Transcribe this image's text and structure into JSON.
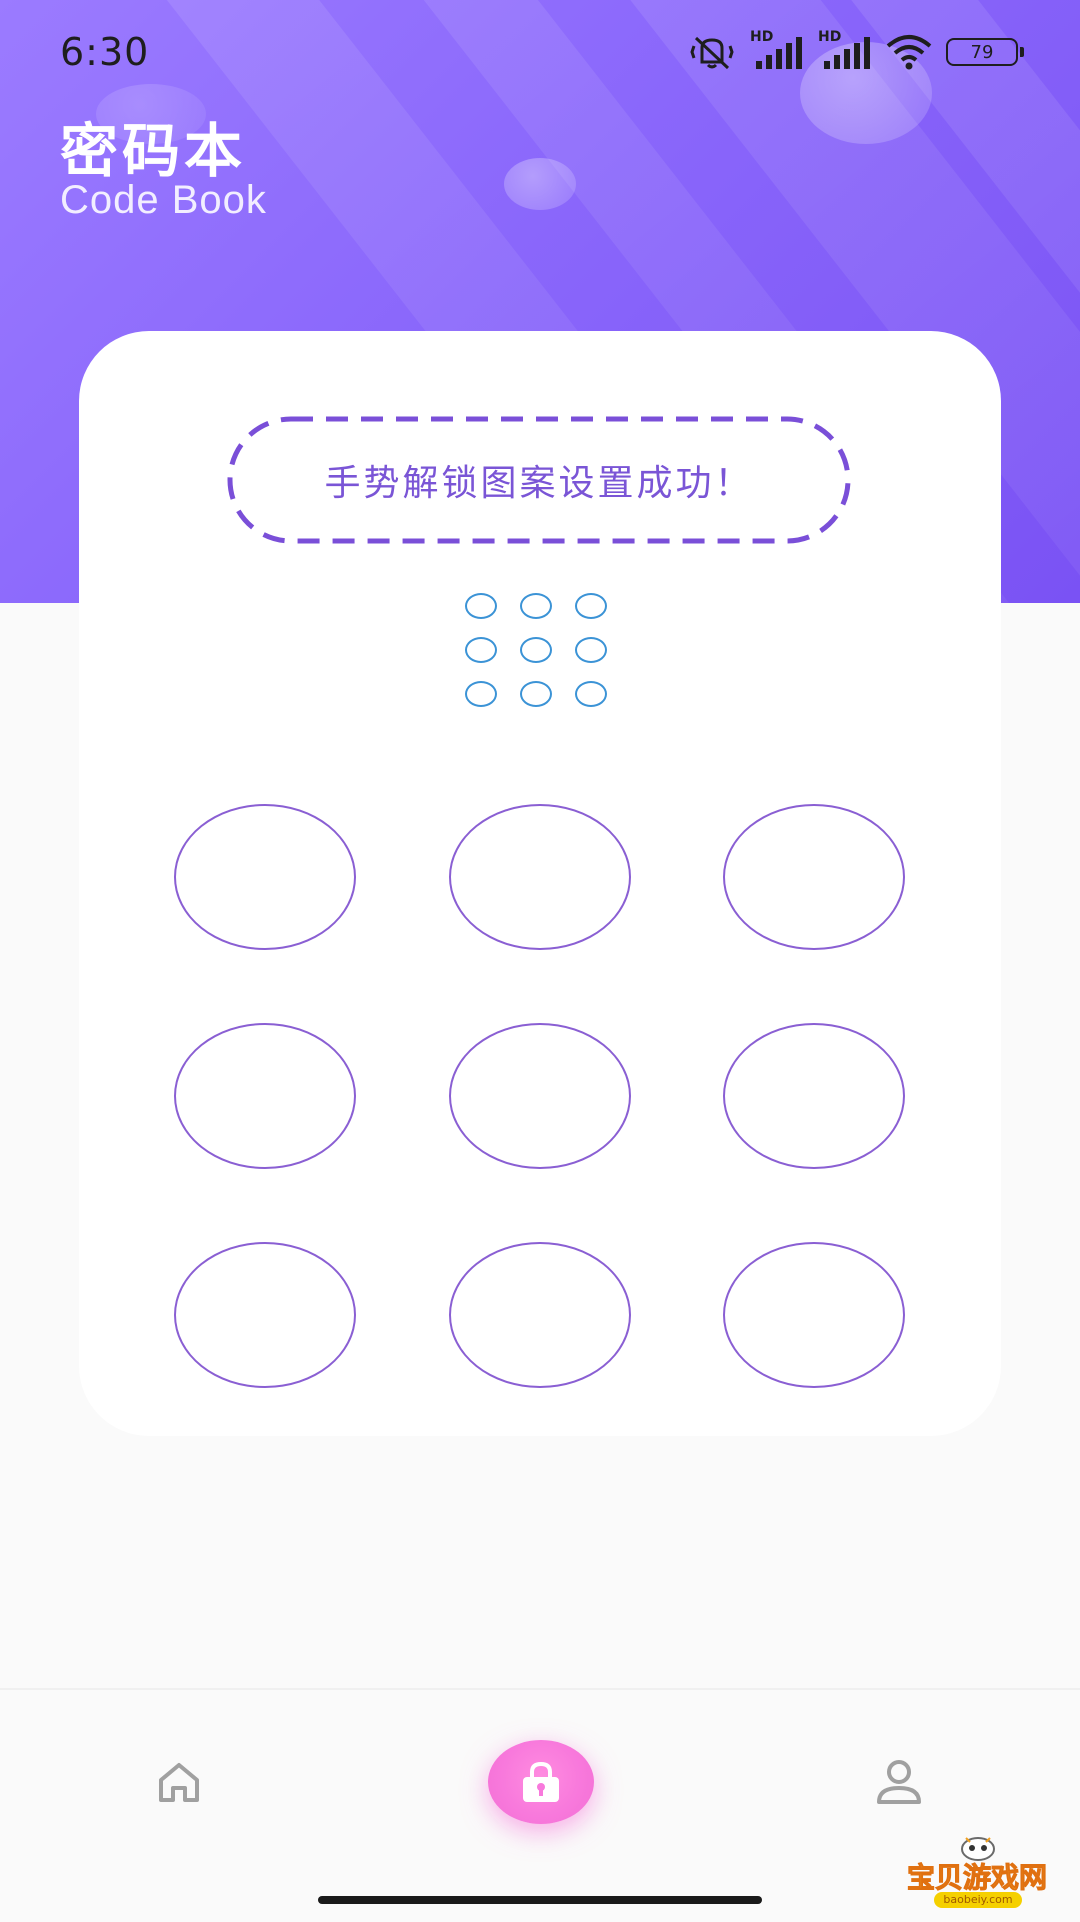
{
  "status_bar": {
    "time": "6:30",
    "battery": "79",
    "network_1": "HD",
    "network_2": "HD"
  },
  "header": {
    "title": "密码本",
    "subtitle": "Code Book"
  },
  "gesture": {
    "message": "手势解锁图案设置成功！",
    "nodes": 9
  },
  "bottom_nav": {
    "items": [
      {
        "name": "home",
        "icon": "home-icon"
      },
      {
        "name": "lock",
        "icon": "lock-icon",
        "active": true
      },
      {
        "name": "profile",
        "icon": "user-icon"
      }
    ]
  },
  "watermark": {
    "text": "宝贝游戏网",
    "sub": "baobeiy.com"
  },
  "colors": {
    "header_gradient_start": "#9b7bff",
    "header_gradient_end": "#7a52f4",
    "accent_purple": "#8a5fd3",
    "mini_dot_blue": "#3b93d6",
    "active_tab_pink": "#f879dc"
  }
}
